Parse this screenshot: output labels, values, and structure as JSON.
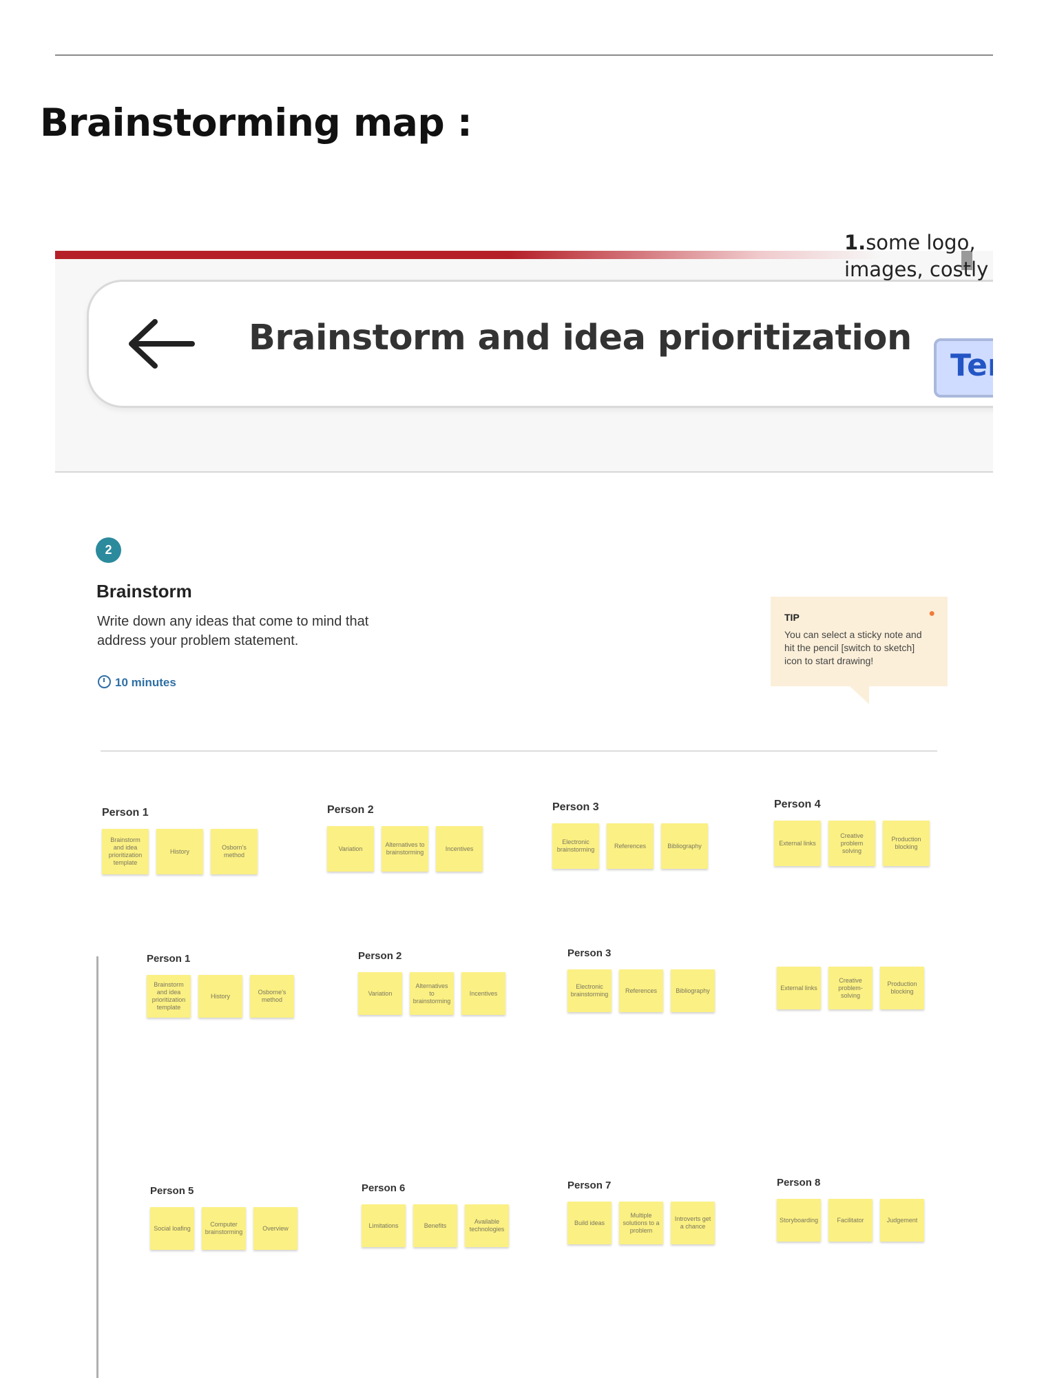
{
  "page_title": "Brainstorming map :",
  "side_note": {
    "number": "1.",
    "text": "some logo, images, costly"
  },
  "header": {
    "title": "Brainstorm and idea prioritization",
    "template_button": "Temp"
  },
  "step": {
    "number": "2",
    "title": "Brainstorm",
    "description": "Write down any ideas that come to mind that address your problem statement.",
    "timer": "10 minutes"
  },
  "tip": {
    "label": "TIP",
    "text": "You can select a sticky note and hit the pencil [switch to sketch] icon to start drawing!"
  },
  "board_top": [
    {
      "person": "Person 1",
      "notes": [
        "Brainstorm and idea prioritization template",
        "History",
        "Osborn's method"
      ]
    },
    {
      "person": "Person 2",
      "notes": [
        "Variation",
        "Alternatives to brainstorming",
        "Incentives"
      ]
    },
    {
      "person": "Person 3",
      "notes": [
        "Electronic brainstorming",
        "References",
        "Bibliography"
      ]
    },
    {
      "person": "Person 4",
      "notes": [
        "External links",
        "Creative problem solving",
        "Production blocking"
      ]
    }
  ],
  "board_middle": [
    {
      "person": "Person 1",
      "notes": [
        "Brainstorm and idea prioritization template",
        "History",
        "Osborne's method"
      ]
    },
    {
      "person": "Person 2",
      "notes": [
        "Variation",
        "Alternatives to brainstorming",
        "Incentives"
      ]
    },
    {
      "person": "Person 3",
      "notes": [
        "Electronic brainstorming",
        "References",
        "Bibliography"
      ]
    },
    {
      "person": "",
      "notes": [
        "External links",
        "Creative problem-solving",
        "Production blocking"
      ]
    }
  ],
  "board_bottom": [
    {
      "person": "Person 5",
      "notes": [
        "Social loafing",
        "Computer brainstorming",
        "Overview"
      ]
    },
    {
      "person": "Person 6",
      "notes": [
        "Limitations",
        "Benefits",
        "Available technologies"
      ]
    },
    {
      "person": "Person 7",
      "notes": [
        "Build ideas",
        "Multiple solutions to a problem",
        "Introverts get a chance"
      ]
    },
    {
      "person": "Person 8",
      "notes": [
        "Storyboarding",
        "Facilitator",
        "Judgement"
      ]
    }
  ]
}
